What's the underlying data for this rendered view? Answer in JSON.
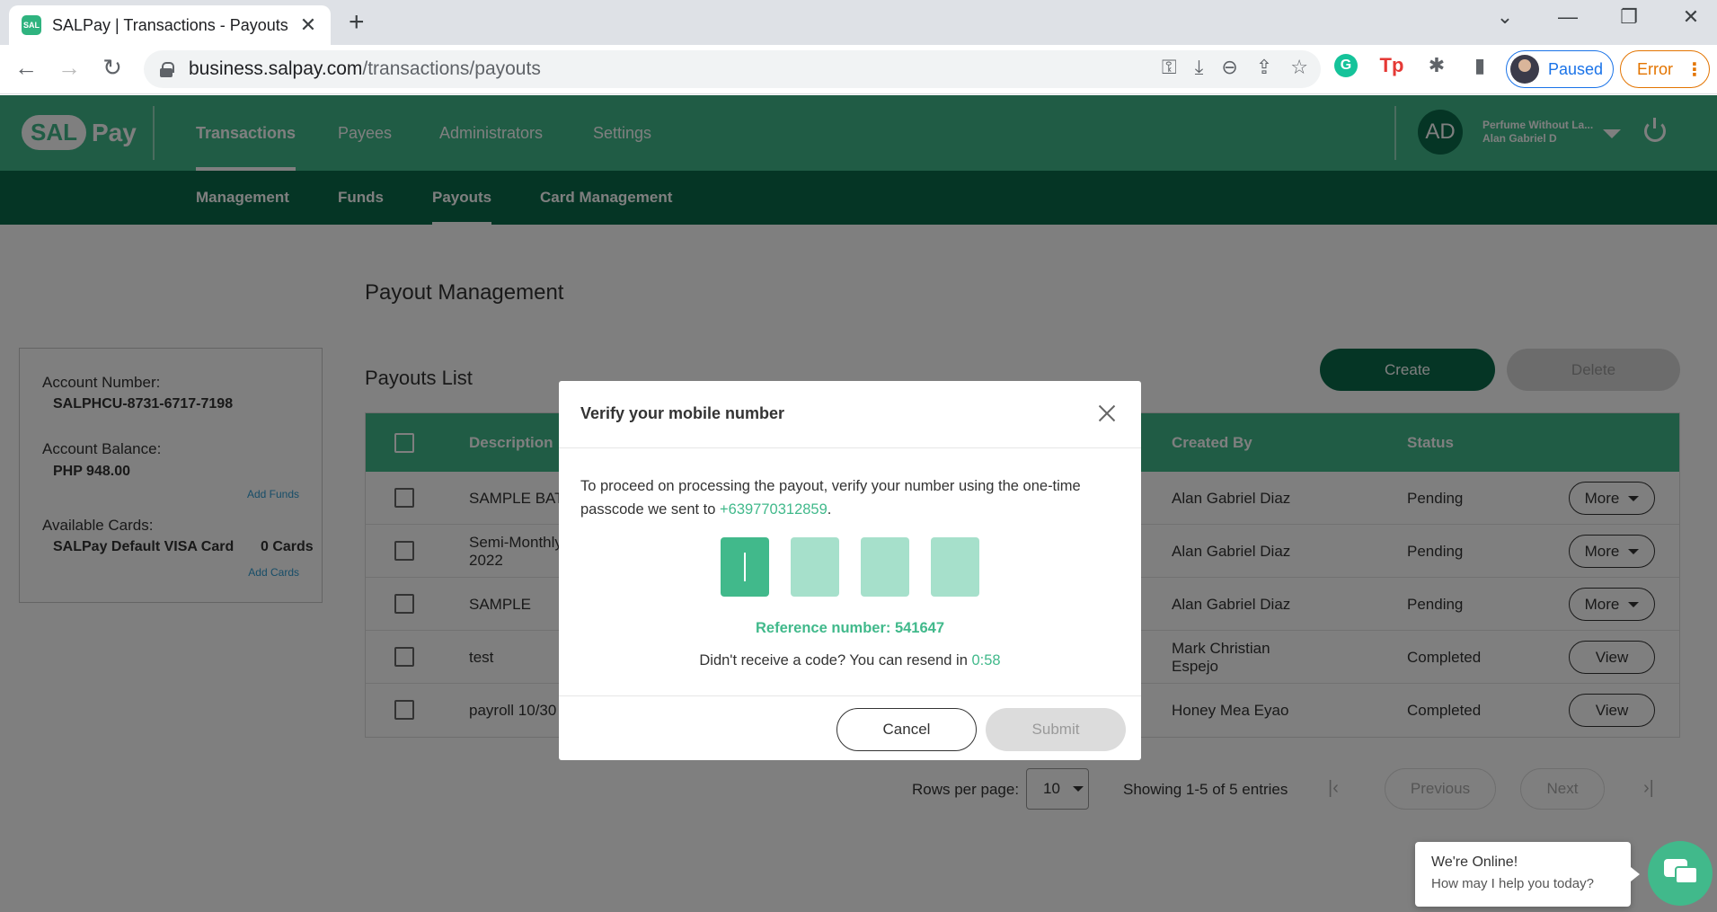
{
  "browser": {
    "tab_title": "SALPay | Transactions - Payouts",
    "favicon_text": "SAL",
    "url_host": "business.salpay.com",
    "url_path": "/transactions/payouts",
    "profile_label": "Paused",
    "error_label": "Error"
  },
  "header": {
    "logo_sal": "SAL",
    "logo_pay": "Pay",
    "nav": [
      "Transactions",
      "Payees",
      "Administrators",
      "Settings"
    ],
    "user_initials": "AD",
    "user_company": "Perfume Without La...",
    "user_name": "Alan Gabriel D"
  },
  "subnav": [
    "Management",
    "Funds",
    "Payouts",
    "Card Management"
  ],
  "page": {
    "title": "Payout Management",
    "list_title": "Payouts List",
    "create_label": "Create",
    "delete_label": "Delete"
  },
  "account": {
    "number_label": "Account Number:",
    "number": "SALPHCU-8731-6717-7198",
    "balance_label": "Account Balance:",
    "balance": "PHP 948.00",
    "add_funds": "Add Funds",
    "cards_label": "Available Cards:",
    "card_name": "SALPay Default VISA Card",
    "card_count": "0 Cards",
    "add_cards": "Add Cards"
  },
  "table": {
    "headers": [
      "Description",
      "Created By",
      "Status"
    ],
    "rows": [
      {
        "description": "SAMPLE BAT",
        "created_by": "Alan Gabriel Diaz",
        "status": "Pending",
        "action": "More"
      },
      {
        "description": "Semi-Monthly\n2022",
        "created_by": "Alan Gabriel Diaz",
        "status": "Pending",
        "action": "More"
      },
      {
        "description": "SAMPLE",
        "created_by": "Alan Gabriel Diaz",
        "status": "Pending",
        "action": "More"
      },
      {
        "description": "test",
        "created_by": "Mark Christian\nEspejo",
        "status": "Completed",
        "action": "View"
      },
      {
        "description": "payroll 10/30",
        "created_by": "Honey Mea Eyao",
        "status": "Completed",
        "action": "View"
      }
    ]
  },
  "pagination": {
    "rows_label": "Rows per page:",
    "rows_value": "10",
    "showing": "Showing 1-5 of 5 entries",
    "previous": "Previous",
    "next": "Next"
  },
  "modal": {
    "title": "Verify your mobile number",
    "text": "To proceed on processing the payout, verify your number using the one-time passcode we sent to ",
    "phone": "+639770312859",
    "text_end": ".",
    "reference": "Reference number: 541647",
    "resend_text": "Didn't receive a code? You can resend in ",
    "timer": "0:58",
    "cancel_label": "Cancel",
    "submit_label": "Submit"
  },
  "chat": {
    "title": "We're Online!",
    "subtitle": "How may I help you today?"
  },
  "colors": {
    "brand_green": "#41b98b",
    "dark_green": "#0b6b4b"
  }
}
